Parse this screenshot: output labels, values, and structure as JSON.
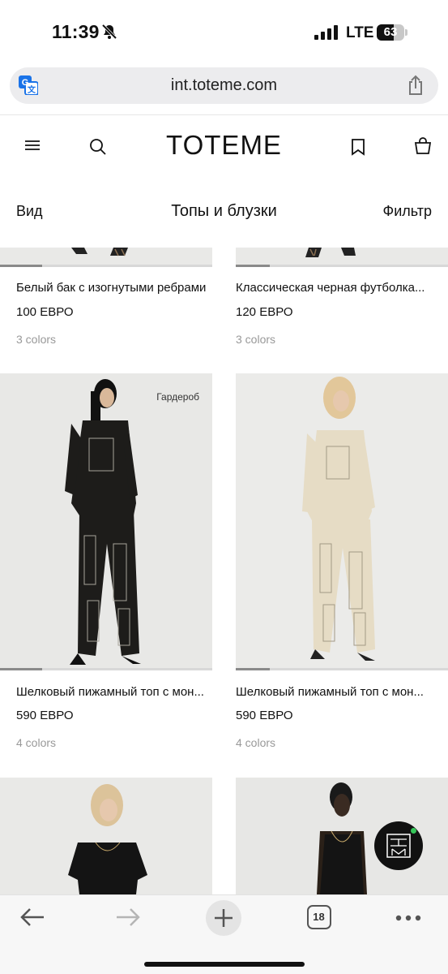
{
  "status_bar": {
    "time": "11:39",
    "network": "LTE",
    "battery": "63",
    "battery_level": 0.63
  },
  "browser": {
    "url": "int.toteme.com",
    "tabs_count": "18"
  },
  "site": {
    "logo": "TOTEME",
    "view_label": "Вид",
    "category_title": "Топы и блузки",
    "filter_label": "Фильтр"
  },
  "products": [
    {
      "name": "Белый бак с изогнутыми ребрами",
      "price": "100 ЕВРО",
      "colors": "3 colors",
      "tag": ""
    },
    {
      "name": "Классическая черная футболка...",
      "price": "120 ЕВРО",
      "colors": "3 colors",
      "tag": ""
    },
    {
      "name": "Шелковый пижамный топ с мон...",
      "price": "590 ЕВРО",
      "colors": "4 colors",
      "tag": "Гардероб"
    },
    {
      "name": "Шелковый пижамный топ с мон...",
      "price": "590 ЕВРО",
      "colors": "4 colors",
      "tag": ""
    }
  ],
  "colors": {
    "accent": "#111111",
    "muted": "#999999",
    "notify_dot": "#35c759"
  }
}
